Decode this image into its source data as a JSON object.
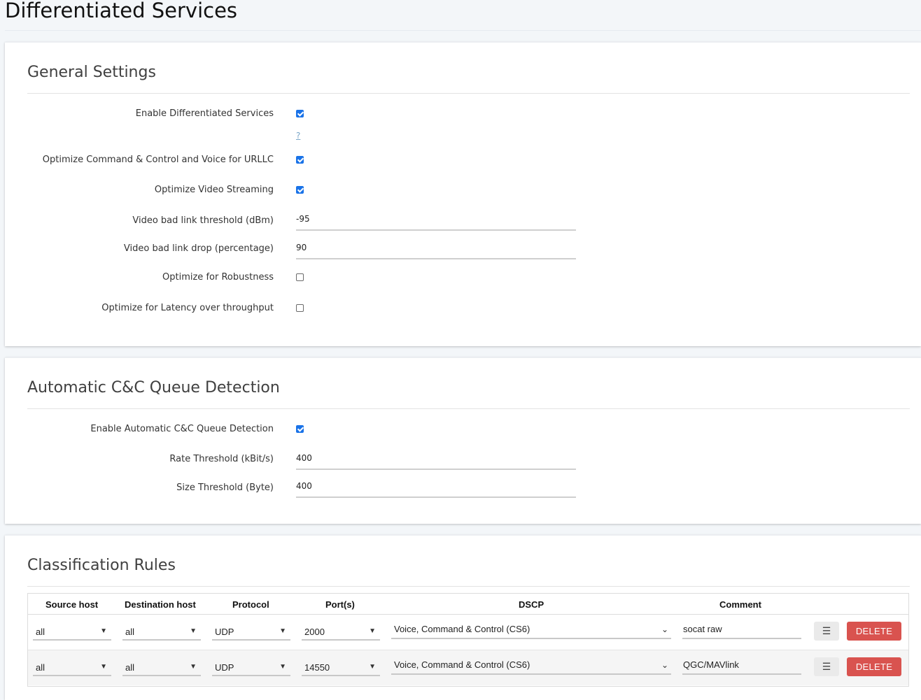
{
  "page": {
    "title": "Differentiated Services"
  },
  "general": {
    "title": "General Settings",
    "help_link": "?",
    "fields": [
      {
        "label": "Enable Differentiated Services",
        "type": "checkbox",
        "checked": true
      },
      {
        "label": "Optimize Command & Control and Voice for URLLC",
        "type": "checkbox",
        "checked": true
      },
      {
        "label": "Optimize Video Streaming",
        "type": "checkbox",
        "checked": true
      },
      {
        "label": "Video bad link threshold (dBm)",
        "type": "text",
        "value": "-95"
      },
      {
        "label": "Video bad link drop (percentage)",
        "type": "text",
        "value": "90"
      },
      {
        "label": "Optimize for Robustness",
        "type": "checkbox",
        "checked": false
      },
      {
        "label": "Optimize for Latency over throughput",
        "type": "checkbox",
        "checked": false
      }
    ]
  },
  "cc": {
    "title": "Automatic C&C Queue Detection",
    "fields": [
      {
        "label": "Enable Automatic C&C Queue Detection",
        "type": "checkbox",
        "checked": true
      },
      {
        "label": "Rate Threshold (kBit/s)",
        "type": "text",
        "value": "400"
      },
      {
        "label": "Size Threshold (Byte)",
        "type": "text",
        "value": "400"
      }
    ]
  },
  "rules": {
    "title": "Classification Rules",
    "headers": [
      "Source host",
      "Destination host",
      "Protocol",
      "Port(s)",
      "DSCP",
      "Comment"
    ],
    "rows": [
      {
        "source": "all",
        "destination": "all",
        "protocol": "UDP",
        "ports": "2000",
        "dscp": "Voice, Command & Control (CS6)",
        "comment": "socat raw",
        "menu": "☰",
        "delete": "DELETE"
      },
      {
        "source": "all",
        "destination": "all",
        "protocol": "UDP",
        "ports": "14550",
        "dscp": "Voice, Command & Control (CS6)",
        "comment": "QGC/MAVlink",
        "menu": "☰",
        "delete": "DELETE"
      }
    ]
  },
  "icons": {
    "select_arrow": "▼",
    "dscp_chevron": "⌄",
    "menu_icon": "☰"
  },
  "colors": {
    "checkbox_on": "#1a73e8",
    "delete_button": "#d9534f",
    "help_link": "#7aa6c8"
  }
}
